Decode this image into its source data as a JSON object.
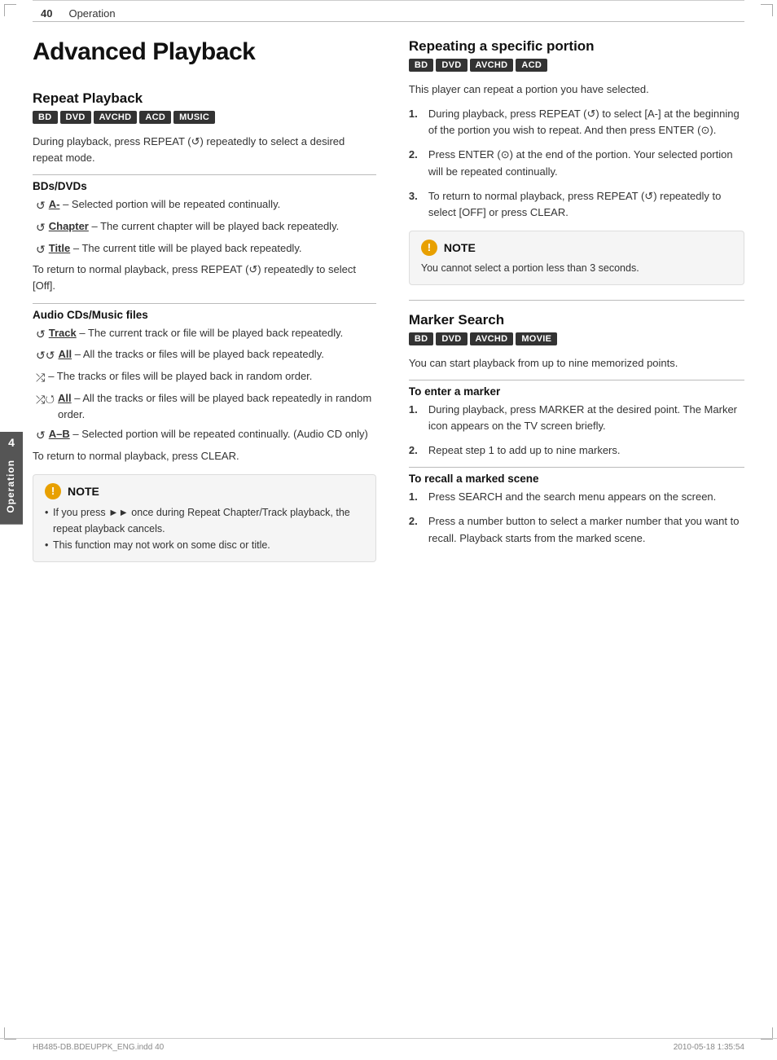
{
  "page": {
    "number": "40",
    "section": "Operation",
    "title": "Advanced Playback"
  },
  "repeat_playback": {
    "heading": "Repeat Playback",
    "badges": [
      "BD",
      "DVD",
      "AVCHD",
      "ACD",
      "MUSIC"
    ],
    "intro": "During playback, press REPEAT (↺) repeatedly to select a desired repeat mode.",
    "bds_dvds": {
      "heading": "BDs/DVDs",
      "items": [
        {
          "icon": "↺",
          "bold": "A-",
          "text": " – Selected portion will be repeated continually."
        },
        {
          "icon": "↺",
          "bold": "Chapter",
          "text": " – The current chapter will be played back repeatedly."
        },
        {
          "icon": "↺",
          "bold": "Title",
          "text": " – The current title will be played back repeatedly."
        }
      ],
      "footer": "To return to normal playback, press REPEAT (↺) repeatedly to select [Off]."
    },
    "audio_cds": {
      "heading": "Audio CDs/Music files",
      "items": [
        {
          "icon": "↺",
          "bold": "Track",
          "text": " – The current track or file will be played back repeatedly."
        },
        {
          "icon": "↺↺",
          "bold": "All",
          "text": " – All the tracks or files will be played back repeatedly."
        },
        {
          "icon": "⤮",
          "bold": "",
          "text": " – The tracks or files will be played back in random order."
        },
        {
          "icon": "⤮↺",
          "bold": "All",
          "text": " – All the tracks or files will be played back repeatedly in random order."
        },
        {
          "icon": "↺",
          "bold": "A–B",
          "text": " – Selected portion will be repeated continually. (Audio CD only)"
        }
      ],
      "footer": "To return to normal playback, press CLEAR."
    }
  },
  "note1": {
    "title": "NOTE",
    "bullets": [
      "If you press ►► once during Repeat Chapter/Track playback, the repeat playback cancels.",
      "This function may not work on some disc or title."
    ]
  },
  "repeating_specific": {
    "heading": "Repeating a specific portion",
    "badges": [
      "BD",
      "DVD",
      "AVCHD",
      "ACD"
    ],
    "intro": "This player can repeat a portion you have selected.",
    "steps": [
      {
        "num": "1.",
        "text": "During playback, press REPEAT (↺) to select [A-] at the beginning of the portion you wish to repeat. And then press ENTER (⊙)."
      },
      {
        "num": "2.",
        "text": "Press ENTER (⊙) at the end of the portion. Your selected portion will be repeated continually."
      },
      {
        "num": "3.",
        "text": "To return to normal playback, press REPEAT (↺) repeatedly to select [OFF] or press CLEAR."
      }
    ]
  },
  "note2": {
    "title": "NOTE",
    "text": "You cannot select a portion less than 3 seconds."
  },
  "marker_search": {
    "heading": "Marker Search",
    "badges": [
      "BD",
      "DVD",
      "AVCHD",
      "MOVIE"
    ],
    "intro": "You can start playback from up to nine memorized points.",
    "enter_marker": {
      "heading": "To enter a marker",
      "steps": [
        {
          "num": "1.",
          "text": "During playback, press MARKER at the desired point. The Marker icon appears on the TV screen briefly."
        },
        {
          "num": "2.",
          "text": "Repeat step 1 to add up to nine markers."
        }
      ]
    },
    "recall_marker": {
      "heading": "To recall a marked scene",
      "steps": [
        {
          "num": "1.",
          "text": "Press SEARCH and the search menu appears on the screen."
        },
        {
          "num": "2.",
          "text": "Press a number button to select a marker number that you want to recall. Playback starts from the marked scene."
        }
      ]
    }
  },
  "footer": {
    "left": "HB485-DB.BDEUPPK_ENG.indd   40",
    "right": "2010-05-18     1:35:54"
  },
  "side_tab": {
    "number": "4",
    "label": "Operation"
  }
}
